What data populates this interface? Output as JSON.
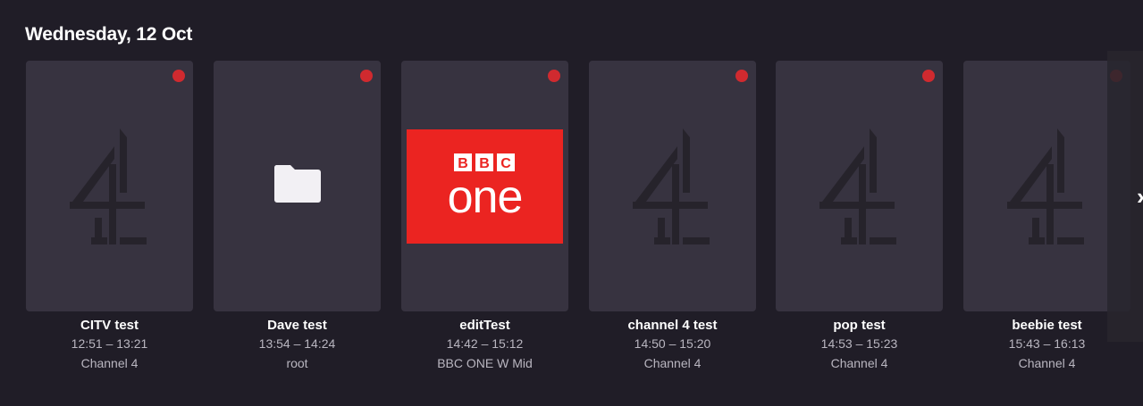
{
  "schedule": {
    "date_heading": "Wednesday, 12 Oct",
    "programmes": [
      {
        "title": "CITV test",
        "time": "12:51 – 13:21",
        "channel": "Channel 4",
        "logo": "channel-4-logo",
        "recording": true
      },
      {
        "title": "Dave test",
        "time": "13:54 – 14:24",
        "channel": "root",
        "logo": "folder-icon",
        "recording": true
      },
      {
        "title": "editTest",
        "time": "14:42 – 15:12",
        "channel": "BBC ONE W Mid",
        "logo": "bbc-one-logo",
        "recording": true,
        "logo_text": {
          "bbc": "BBC",
          "one": "one"
        }
      },
      {
        "title": "channel 4 test",
        "time": "14:50 – 15:20",
        "channel": "Channel 4",
        "logo": "channel-4-logo",
        "recording": true
      },
      {
        "title": "pop test",
        "time": "14:53 – 15:23",
        "channel": "Channel 4",
        "logo": "channel-4-logo",
        "recording": true
      },
      {
        "title": "beebie test",
        "time": "15:43 – 16:13",
        "channel": "Channel 4",
        "logo": "channel-4-logo",
        "recording": true
      }
    ]
  },
  "carousel": {
    "next_icon": "chevron-right-icon",
    "next_glyph": "›"
  },
  "colors": {
    "background": "#201d27",
    "card": "#373340",
    "record_dot": "#d02a2f",
    "bbc_red": "#eb2421"
  }
}
